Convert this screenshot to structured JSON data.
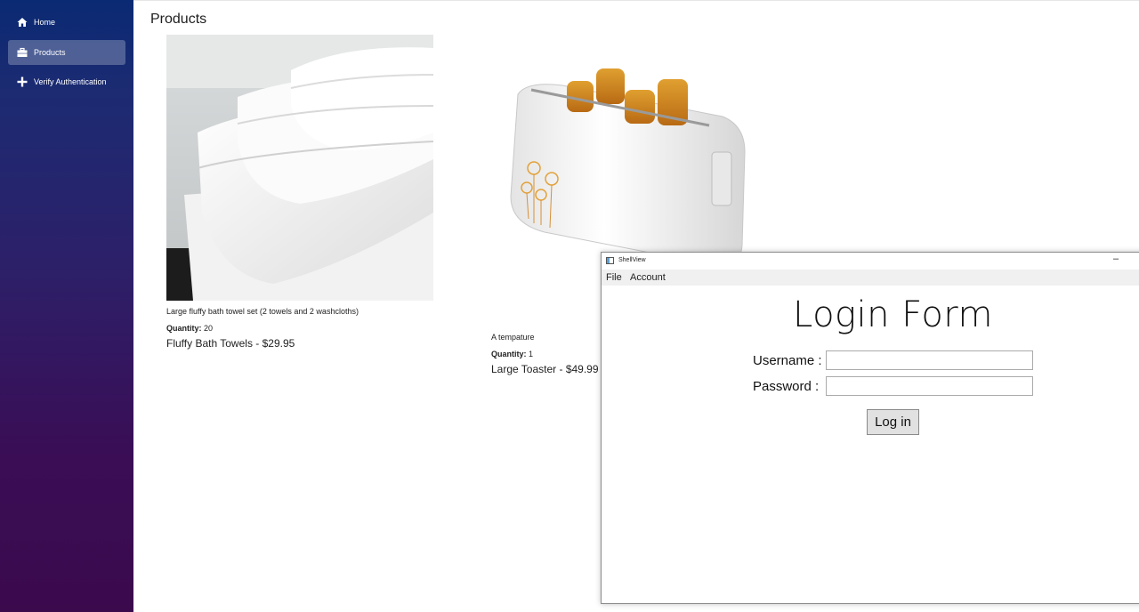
{
  "sidebar": {
    "items": [
      {
        "label": "Home",
        "icon": "home-icon"
      },
      {
        "label": "Products",
        "icon": "briefcase-icon"
      },
      {
        "label": "Verify Authentication",
        "icon": "plus-icon"
      }
    ],
    "active_index": 1
  },
  "main": {
    "title": "Products",
    "products": [
      {
        "description": "Large fluffy bath towel set (2 towels and 2 washcloths)",
        "quantity_label": "Quantity:",
        "quantity": "20",
        "name_price": "Fluffy Bath Towels - $29.95",
        "image": "towels-image"
      },
      {
        "description": "A tempature",
        "quantity_label": "Quantity:",
        "quantity": "1",
        "name_price": "Large Toaster - $49.99",
        "image": "toaster-image"
      }
    ]
  },
  "login_window": {
    "title": "ShellView",
    "minimize_glyph": "–",
    "menu": [
      "File",
      "Account"
    ],
    "heading": "Login Form",
    "username_label": "Username :",
    "password_label": "Password :",
    "username_value": "",
    "password_value": "",
    "login_button": "Log in"
  }
}
